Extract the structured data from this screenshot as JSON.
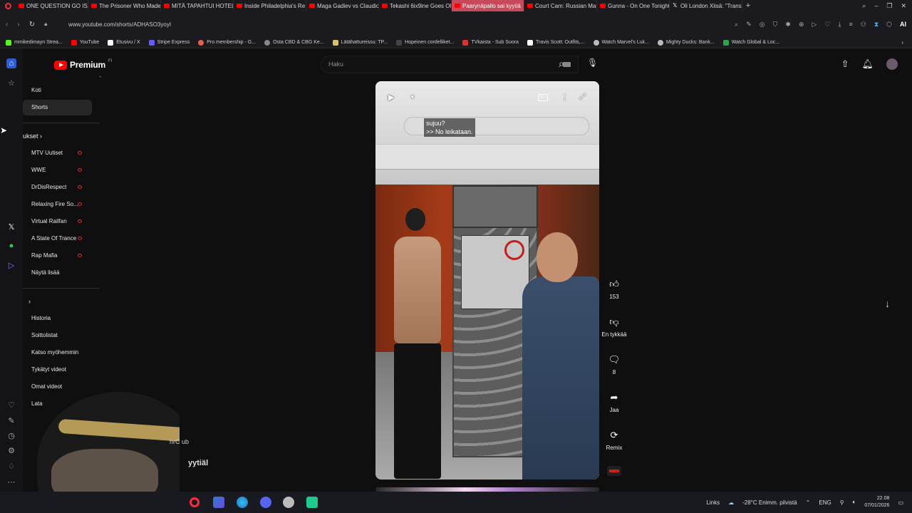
{
  "browser": {
    "tabs": [
      {
        "label": "ONE QUESTION GO IS BA",
        "icon": "youtube-icon"
      },
      {
        "label": "The Prisoner Who Made",
        "icon": "youtube-icon"
      },
      {
        "label": "MITÄ TAPAHTUI HOTELLI",
        "icon": "youtube-icon"
      },
      {
        "label": "Inside Philadelphia's Re",
        "icon": "youtube-icon"
      },
      {
        "label": "Maga Gadiev vs Claudio",
        "icon": "youtube-icon"
      },
      {
        "label": "Tekashi 6ix9ine Goes Off",
        "icon": "youtube-icon"
      },
      {
        "label": "Paarynäpallo sai kyytiä",
        "icon": "youtube-icon",
        "active": true
      },
      {
        "label": "Court Cam: Russian Man",
        "icon": "youtube-icon"
      },
      {
        "label": "Gunna - On One Tonight",
        "icon": "youtube-icon"
      },
      {
        "label": "Oli London Xiisä: \"Trans",
        "icon": "x-icon"
      }
    ],
    "url": "www.youtube.com/shorts/ADHASO3yoyI",
    "ai_label": "AI",
    "bookmarks": [
      {
        "label": "mmikedimayn Strea...",
        "color": "#53fc18"
      },
      {
        "label": "YouTube",
        "color": "#ff0000"
      },
      {
        "label": "Etusivu / X",
        "color": "#ffffff"
      },
      {
        "label": "Stripe Express",
        "color": "#635bff"
      },
      {
        "label": "Pro membership - G...",
        "color": "#e85d4a"
      },
      {
        "label": "Osta CBD & CBG Ke...",
        "color": "#888888"
      },
      {
        "label": "Lätähattureissu: TP...",
        "color": "#d4c36a"
      },
      {
        "label": "Hopeinen cordelliket...",
        "color": "#444444"
      },
      {
        "label": "TVkaista - Sub Suora",
        "color": "#e0322d"
      },
      {
        "label": "Travis Scott: Outfits,...",
        "color": "#ffffff"
      },
      {
        "label": "Watch Marvel's Luk...",
        "color": "#bbbbbb"
      },
      {
        "label": "Mighty Ducks: Bank...",
        "color": "#bbbbbb"
      },
      {
        "label": "Watch Global & Loc...",
        "color": "#2aa54a"
      }
    ]
  },
  "youtube": {
    "logo_text": "Premium",
    "logo_region": "FI",
    "search_placeholder": "Haku",
    "guide": {
      "main": [
        "Koti",
        "Shorts"
      ],
      "subs_heading": "ukset",
      "subscriptions": [
        "MTV Uutiset",
        "WWE",
        "DrDisRespect",
        "Relaxing Fire So...",
        "Virtual Railfan",
        "A State Of Trance",
        "Rap Mafia"
      ],
      "show_more": "Näytä lisää",
      "you_items": [
        "Historia",
        "Soittolistat",
        "Katso myöhemmin",
        "Tykätyt videot",
        "Omat videot",
        "Lata"
      ]
    },
    "short": {
      "subtitle_line1": "sujuu?",
      "subtitle_line2": ">> No leikataan.",
      "cc_label": "CC",
      "likes": "153",
      "dislike_label": "En tykkää",
      "comments": "8",
      "share_label": "Jaa",
      "remix_label": "Remix",
      "progress_fraction": 0.5
    }
  },
  "overlay": {
    "text1": "hrC ub",
    "text2": "yytiäl"
  },
  "taskbar": {
    "links_label": "Links",
    "weather": "-28°C  Enimm. pilvistä",
    "language": "ENG",
    "time": "22.08",
    "date": "07/01/2026"
  }
}
